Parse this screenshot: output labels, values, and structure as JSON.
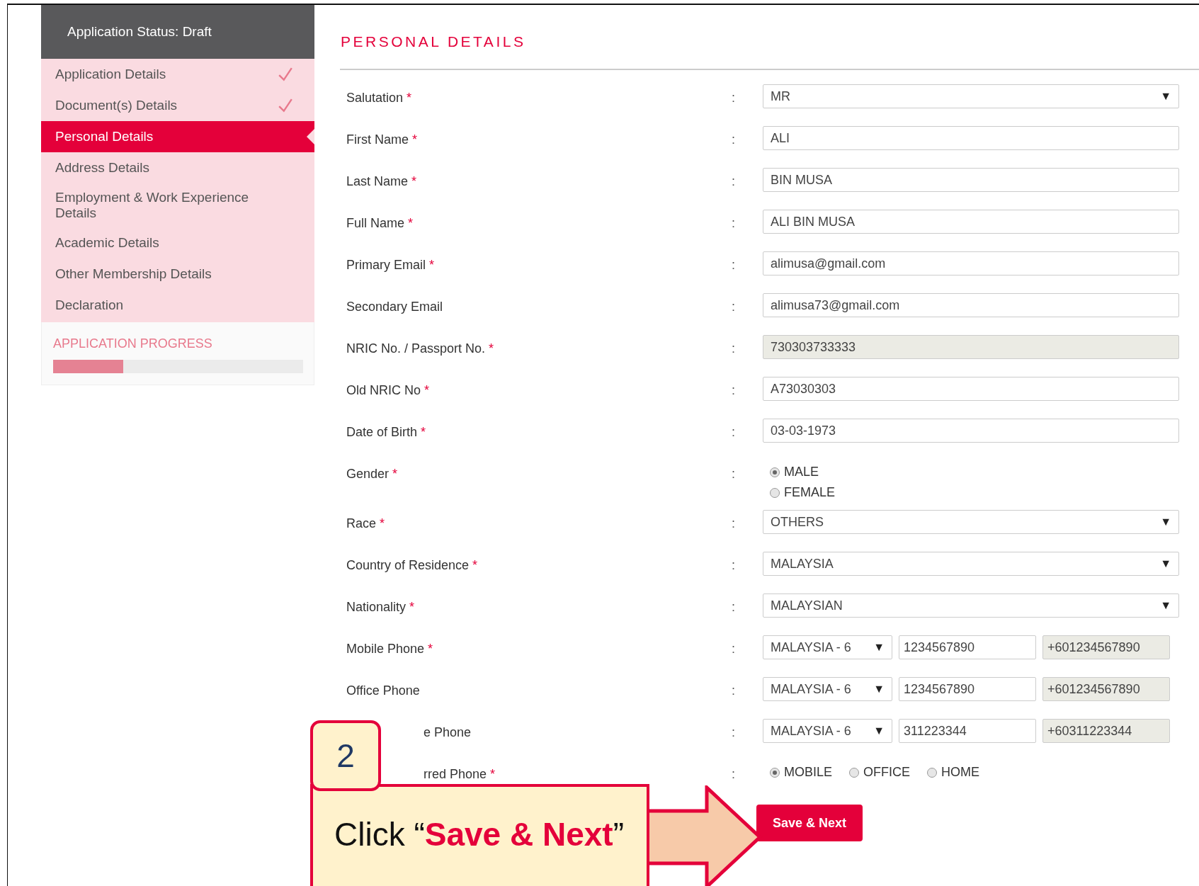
{
  "sidebar": {
    "status_title": "Application Status: Draft",
    "items": [
      {
        "label": "Application Details",
        "completed": true,
        "selected": false
      },
      {
        "label": "Document(s) Details",
        "completed": true,
        "selected": false
      },
      {
        "label": "Personal Details",
        "completed": false,
        "selected": true
      },
      {
        "label": "Address Details",
        "completed": false,
        "selected": false
      },
      {
        "label": "Employment & Work Experience Details",
        "completed": false,
        "selected": false
      },
      {
        "label": "Academic Details",
        "completed": false,
        "selected": false
      },
      {
        "label": "Other Membership Details",
        "completed": false,
        "selected": false
      },
      {
        "label": "Declaration",
        "completed": false,
        "selected": false
      }
    ],
    "progress": {
      "title": "APPLICATION PROGRESS",
      "level": 0.28
    }
  },
  "form": {
    "title": "PERSONAL DETAILS",
    "fields": [
      {
        "label": "Salutation",
        "required_mark": "*",
        "separator": ":",
        "kind": "select",
        "value": "MR",
        "arrow": "▼"
      },
      {
        "label": "First Name",
        "required_mark": "*",
        "separator": ":",
        "kind": "text",
        "value": "ALI"
      },
      {
        "label": "Last Name",
        "required_mark": "*",
        "separator": ":",
        "kind": "text",
        "value": "BIN MUSA"
      },
      {
        "label": "Full Name",
        "required_mark": "*",
        "separator": ":",
        "kind": "text",
        "value": "ALI BIN MUSA"
      },
      {
        "label": "Primary Email",
        "required_mark": "*",
        "separator": ":",
        "kind": "text",
        "value": "alimusa@gmail.com"
      },
      {
        "label": "Secondary Email",
        "separator": ":",
        "kind": "text",
        "value": "alimusa73@gmail.com"
      },
      {
        "label": "NRIC No. / Passport No.",
        "required_mark": "*",
        "separator": ":",
        "kind": "readonly",
        "value": "730303733333"
      },
      {
        "label": "Old NRIC No",
        "required_mark": "*",
        "separator": ":",
        "kind": "text",
        "value": "A73030303"
      },
      {
        "label": "Date of Birth",
        "required_mark": "*",
        "separator": ":",
        "kind": "text",
        "value": "03-03-1973"
      },
      {
        "label": "Gender",
        "required_mark": "*",
        "separator": ":",
        "kind": "radio_stack",
        "options": [
          {
            "label": "MALE",
            "selected": true
          },
          {
            "label": "FEMALE",
            "selected": false
          }
        ]
      },
      {
        "label": "Race",
        "required_mark": "*",
        "separator": ":",
        "kind": "select",
        "value": "OTHERS",
        "arrow": "▼"
      },
      {
        "label": "Country of Residence",
        "required_mark": "*",
        "separator": ":",
        "kind": "select",
        "value": "MALAYSIA",
        "arrow": "▼"
      },
      {
        "label": "Nationality",
        "required_mark": "*",
        "separator": ":",
        "kind": "select",
        "value": "MALAYSIAN",
        "arrow": "▼"
      },
      {
        "label": "Mobile Phone",
        "required_mark": "*",
        "separator": ":",
        "kind": "phone",
        "country": "MALAYSIA - 6",
        "arrow": "▼",
        "value": "1234567890",
        "full_number": "+601234567890"
      },
      {
        "label": "Office Phone",
        "separator": ":",
        "kind": "phone",
        "country": "MALAYSIA - 6",
        "arrow": "▼",
        "value": "1234567890",
        "full_number": "+601234567890"
      },
      {
        "label": "e Phone",
        "covered": true,
        "separator": ":",
        "kind": "phone",
        "country": "MALAYSIA - 6",
        "arrow": "▼",
        "value": "311223344",
        "full_number": "+60311223344"
      },
      {
        "label": "rred Phone",
        "covered": true,
        "required_mark": "*",
        "separator": ":",
        "kind": "radio_row",
        "options": [
          {
            "label": "MOBILE",
            "selected": true
          },
          {
            "label": "OFFICE",
            "selected": false
          },
          {
            "label": "HOME",
            "selected": false
          }
        ]
      }
    ],
    "submit": "Save & Next"
  },
  "callout": {
    "step": "2",
    "text": "Click “**Save & Next**”"
  }
}
